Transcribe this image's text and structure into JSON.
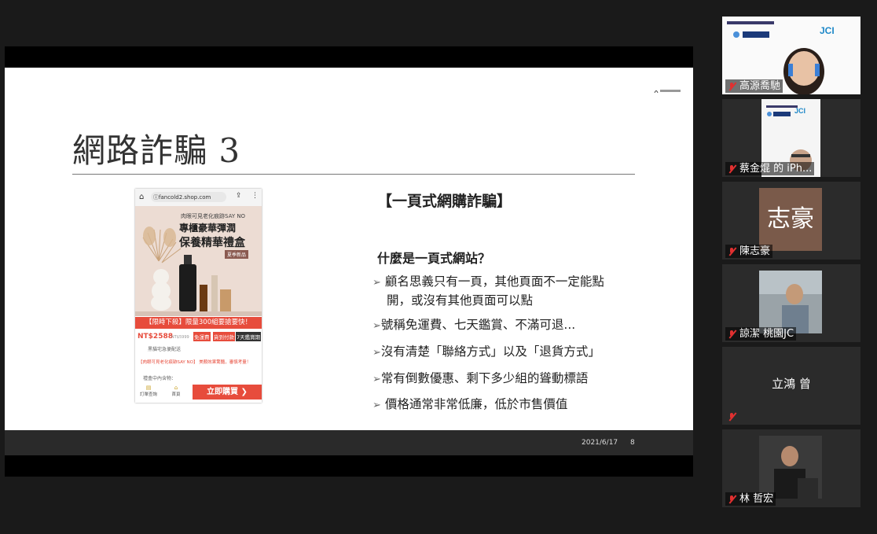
{
  "slide": {
    "title": "網路詐騙 3",
    "heading": "【一頁式網購詐騙】",
    "question": "什麼是一頁式網站？",
    "bullets": [
      "顧名思義只有一頁，其他頁面不一定能點開，或沒有其他頁面可以點",
      "號稱免運費、七天鑑賞、不滿可退...",
      "沒有清楚「聯絡方式」以及「退貨方式」",
      "常有倒數優惠、剩下多少組的聳動標語",
      "價格通常非常低廉，低於市售價值"
    ],
    "bullet_lines": [
      [
        "顧名思義只有一頁，其他頁面不一定能點",
        "開，或沒有其他頁面可以點"
      ],
      [
        "號稱免運費、七天鑑賞、不滿可退..."
      ],
      [
        "沒有清楚「聯絡方式」以及「退貨方式」"
      ],
      [
        "常有倒數優惠、剩下多少組的聳動標語"
      ],
      [
        "價格通常非常低廉，低於市售價值"
      ]
    ],
    "date": "2021/6/17",
    "page": "8"
  },
  "phone": {
    "url": "fancold2.shop.com",
    "promo_line1": "肉眼可見老化痕跡SAY NO",
    "promo_line2": "專櫃豪華彈潤",
    "promo_line3": "保養精華禮盒",
    "promo_tag": "夏季新品",
    "banner": "【限時下殺】限量300組要搶要快！",
    "price": "NT$2588",
    "old_price": "NT$5999",
    "badges": [
      "免運費",
      "貨到付款",
      "7天鑑賞期"
    ],
    "shipping": "黑貓宅急便配送",
    "promo_text": "【肉眼可見老化痕跡SAY NO】 美顏效果驚豔，審慎考量！",
    "gift_contents": "禮盒中內含物：",
    "nav_orders": "訂單查詢",
    "nav_home": "首頁",
    "buy_label": "立即購買 ❯"
  },
  "participants": [
    {
      "name": "高源喬馳"
    },
    {
      "name": "蔡金焜 的 iPh..."
    },
    {
      "name": "陳志豪",
      "avatar_text": "志豪"
    },
    {
      "name": "諒潔 桃園JC"
    },
    {
      "name": "立鴻 曾"
    },
    {
      "name": "林 哲宏"
    }
  ],
  "colors": {
    "accent_red": "#e74c3c",
    "mute_red": "#e03030",
    "background": "#1a1a1a"
  },
  "icons": [
    "home-icon",
    "info-icon",
    "share-icon",
    "menu-dots-icon",
    "mic-muted-icon"
  ]
}
